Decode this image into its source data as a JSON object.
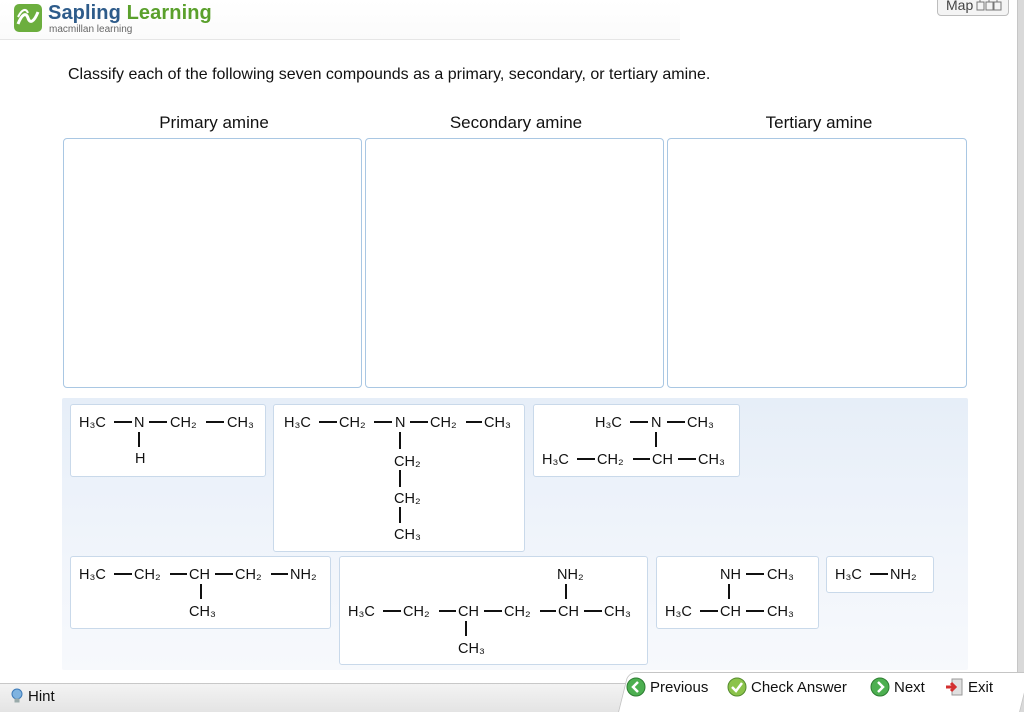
{
  "brand": {
    "name_part1": "Sapling",
    "name_part2": "Learning",
    "subtitle": "macmillan learning"
  },
  "map_button": {
    "label": "Map"
  },
  "question": "Classify each of the following seven compounds as a primary, secondary, or tertiary amine.",
  "categories": [
    "Primary amine",
    "Secondary amine",
    "Tertiary amine"
  ],
  "compounds": {
    "c1": {
      "a": "H₃C",
      "n": "N",
      "b": "CH₂",
      "c": "CH₃",
      "h": "H"
    },
    "c2": {
      "a": "H₃C",
      "b": "CH₂",
      "n": "N",
      "c": "CH₂",
      "d": "CH₃",
      "e": "CH₂",
      "f": "CH₂",
      "g": "CH₃"
    },
    "c3": {
      "a": "H₃C",
      "n": "N",
      "b": "CH₃",
      "c": "H₃C",
      "d": "CH₂",
      "e": "CH",
      "f": "CH₃"
    },
    "c4": {
      "a": "H₃C",
      "b": "CH₂",
      "c": "CH",
      "d": "CH₂",
      "e": "NH₂",
      "f": "CH₃"
    },
    "c5": {
      "top": "NH₂",
      "a": "H₃C",
      "b": "CH₂",
      "c": "CH",
      "d": "CH₂",
      "e": "CH",
      "f": "CH₃",
      "g": "CH₃"
    },
    "c6": {
      "a": "NH",
      "b": "CH₃",
      "c": "H₃C",
      "d": "CH",
      "e": "CH₃"
    },
    "c7": {
      "a": "H₃C",
      "b": "NH₂"
    }
  },
  "footer": {
    "hint": "Hint",
    "previous": "Previous",
    "check_answer": "Check Answer",
    "next": "Next",
    "exit": "Exit"
  },
  "colors": {
    "brand_blue": "#2d5b8a",
    "brand_green": "#5aa02c",
    "drop_border": "#a9c7e3"
  }
}
